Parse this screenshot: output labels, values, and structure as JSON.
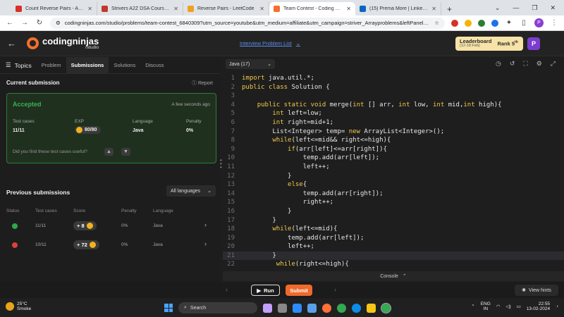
{
  "browser": {
    "tabs": [
      {
        "label": "Count Reverse Pairs - Arrays - T",
        "color": "#d93025",
        "active": false
      },
      {
        "label": "Strivers A2Z DSA Course/Sheet",
        "color": "#c0392b",
        "active": false
      },
      {
        "label": "Reverse Pairs - LeetCode",
        "color": "#f0a020",
        "active": false
      },
      {
        "label": "Team Contest - Coding Ninjas",
        "color": "#f46f2d",
        "active": true
      },
      {
        "label": "(15) Prema More | LinkedIn",
        "color": "#0a66c2",
        "active": false
      }
    ],
    "new_tab": "+",
    "url": "codingninjas.com/studio/problems/team-contest_6840309?utm_source=youtube&utm_medium=affiliate&utm_campaign=striver_Arrayproblems&leftPanelTabValue...",
    "profile_initial": "P"
  },
  "header": {
    "brand": "codingninjas",
    "brand_sub": "/studio",
    "interview_problem_list": "Interview Problem List",
    "leaderboard_title": "Leaderboard",
    "leaderboard_dates": "(12-18 Feb)",
    "rank_label": "Rank 5",
    "rank_sup": "th",
    "avatar": "P"
  },
  "left": {
    "tabs": {
      "topics": "Topics",
      "problem": "Problem",
      "submissions": "Submissions",
      "solutions": "Solutions",
      "discuss": "Discuss"
    },
    "current_submission": "Current submission",
    "report": "Report",
    "accepted": {
      "status": "Accepted",
      "time": "A few seconds ago",
      "cols": {
        "test_cases": "Test cases",
        "exp": "EXP",
        "language": "Language",
        "penalty": "Penalty"
      },
      "vals": {
        "test_cases": "11/11",
        "exp": "80/80",
        "language": "Java",
        "penalty": "0%"
      },
      "feedback_q": "Did you find these test cases useful?"
    },
    "previous": {
      "title": "Previous submissions",
      "language_filter": "All languages",
      "headers": {
        "status": "Status",
        "test_cases": "Test cases",
        "score": "Score",
        "penalty": "Penalty",
        "language": "Language"
      },
      "rows": [
        {
          "status": "ok",
          "test_cases": "11/11",
          "score": "+ 8",
          "penalty": "0%",
          "language": "Java"
        },
        {
          "status": "fail",
          "test_cases": "10/11",
          "score": "+ 72",
          "penalty": "0%",
          "language": "Java"
        }
      ]
    }
  },
  "editor": {
    "language": "Java (17)",
    "lines": [
      {
        "n": "1",
        "t": "import java.util.*;"
      },
      {
        "n": "2",
        "t": "public class Solution {"
      },
      {
        "n": "3",
        "t": ""
      },
      {
        "n": "4",
        "t": "    public static void merge(int [] arr, int low, int mid,int high){"
      },
      {
        "n": "5",
        "t": "        int left=low;"
      },
      {
        "n": "6",
        "t": "        int right=mid+1;"
      },
      {
        "n": "7",
        "t": "        List<Integer> temp= new ArrayList<Integer>();"
      },
      {
        "n": "8",
        "t": "        while(left<=mid&& right<=high){"
      },
      {
        "n": "9",
        "t": "            if(arr[left]<=arr[right]){"
      },
      {
        "n": "10",
        "t": "                temp.add(arr[left]);"
      },
      {
        "n": "11",
        "t": "                left++;"
      },
      {
        "n": "12",
        "t": "            }"
      },
      {
        "n": "13",
        "t": "            else{"
      },
      {
        "n": "14",
        "t": "                temp.add(arr[right]);"
      },
      {
        "n": "15",
        "t": "                right++;"
      },
      {
        "n": "16",
        "t": "            }"
      },
      {
        "n": "17",
        "t": "        }"
      },
      {
        "n": "18",
        "t": "        while(left<=mid){"
      },
      {
        "n": "19",
        "t": "            temp.add(arr[left]);"
      },
      {
        "n": "20",
        "t": "            left++;"
      },
      {
        "n": "21",
        "t": "        }"
      },
      {
        "n": "22",
        "t": "         while(right<=high){"
      }
    ],
    "current_line": 21,
    "console": "Console",
    "run": "Run",
    "submit": "Submit",
    "view_hints": "View hints"
  },
  "taskbar": {
    "temp": "25°C",
    "weather": "Smoke",
    "search": "Search",
    "lang1": "ENG",
    "lang2": "IN",
    "time": "22:55",
    "date": "13-02-2024"
  },
  "colors": {
    "accent": "#f06a2c",
    "accepted": "#38b24d",
    "fail": "#d9423a",
    "keyword": "#f2c94c"
  }
}
